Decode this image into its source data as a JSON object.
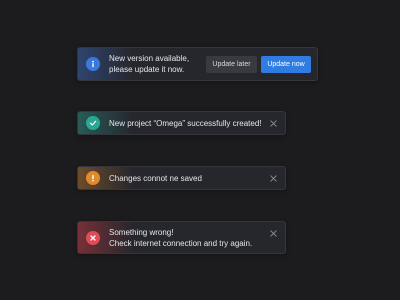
{
  "colors": {
    "background": "#1c1c1e",
    "card": "#26272d",
    "info": "#3b78de",
    "success": "#2aa792",
    "warning": "#e08a2b",
    "error": "#e24a55",
    "primary_button": "#2f7de3"
  },
  "notifications": {
    "info": {
      "icon": "info-icon",
      "line1": "New version available,",
      "line2": "please update it now.",
      "secondary_button": "Update later",
      "primary_button": "Update now"
    },
    "success": {
      "icon": "check-icon",
      "line1": "New project “Omega” successfully created!",
      "close_icon": "close-icon"
    },
    "warning": {
      "icon": "exclamation-icon",
      "line1": "Changes connot ne saved",
      "close_icon": "close-icon"
    },
    "error": {
      "icon": "x-circle-icon",
      "line1": "Something wrong!",
      "line2": "Check internet connection and try again.",
      "close_icon": "close-icon"
    }
  }
}
